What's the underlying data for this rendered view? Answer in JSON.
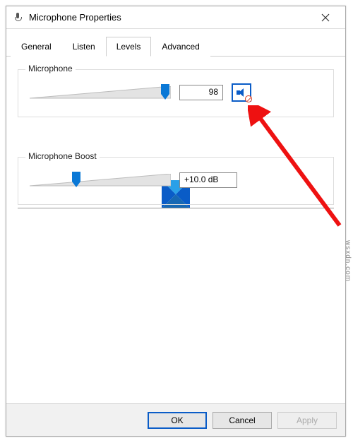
{
  "window": {
    "title": "Microphone Properties"
  },
  "tabs": {
    "items": [
      {
        "label": "General"
      },
      {
        "label": "Listen"
      },
      {
        "label": "Levels"
      },
      {
        "label": "Advanced"
      }
    ],
    "active_index": 2
  },
  "levels": {
    "microphone": {
      "legend": "Microphone",
      "value": "98",
      "thumb_percent": 96,
      "muted": true
    },
    "boost": {
      "legend": "Microphone Boost",
      "value": "+10.0 dB",
      "thumb_percent": 33
    }
  },
  "buttons": {
    "ok": "OK",
    "cancel": "Cancel",
    "apply": "Apply"
  },
  "watermark": "wsxdn.com"
}
